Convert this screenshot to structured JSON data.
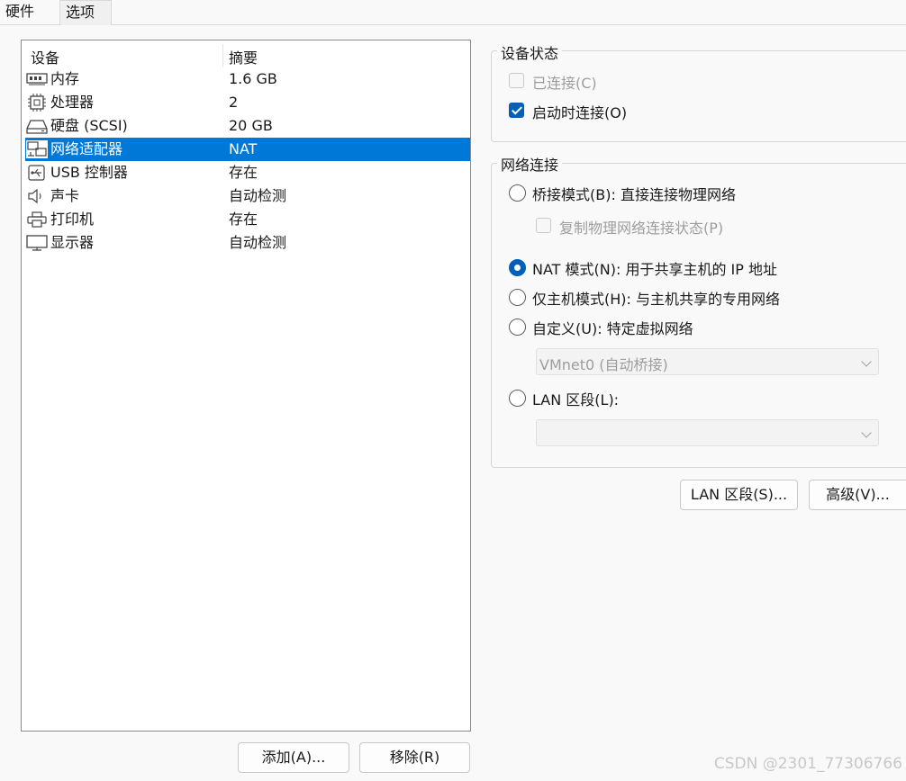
{
  "tabs": [
    {
      "label": "硬件",
      "active": true
    },
    {
      "label": "选项",
      "active": false
    }
  ],
  "device_list": {
    "columns": [
      "设备",
      "摘要"
    ],
    "selected_index": 3,
    "selection_color": "#0078d7",
    "rows": [
      {
        "icon": "memory-icon",
        "name": "内存",
        "summary": "1.6 GB"
      },
      {
        "icon": "processor-icon",
        "name": "处理器",
        "summary": "2"
      },
      {
        "icon": "hard-disk-icon",
        "name": "硬盘 (SCSI)",
        "summary": "20 GB"
      },
      {
        "icon": "network-adapter-icon",
        "name": "网络适配器",
        "summary": "NAT"
      },
      {
        "icon": "usb-icon",
        "name": "USB 控制器",
        "summary": "存在"
      },
      {
        "icon": "speaker-icon",
        "name": "声卡",
        "summary": "自动检测"
      },
      {
        "icon": "printer-icon",
        "name": "打印机",
        "summary": "存在"
      },
      {
        "icon": "display-icon",
        "name": "显示器",
        "summary": "自动检测"
      }
    ]
  },
  "buttons": {
    "add": "添加(A)...",
    "remove": "移除(R)",
    "lan_segments": "LAN 区段(S)...",
    "advanced": "高级(V)..."
  },
  "device_status": {
    "title": "设备状态",
    "connected": {
      "label": "已连接(C)",
      "checked": false,
      "disabled": true
    },
    "connect_at_power_on": {
      "label": "启动时连接(O)",
      "checked": true,
      "disabled": false
    }
  },
  "network_connection": {
    "title": "网络连接",
    "bridged": {
      "label": "桥接模式(B): 直接连接物理网络",
      "checked": false
    },
    "replicate": {
      "label": "复制物理网络连接状态(P)",
      "checked": false,
      "disabled": true
    },
    "nat": {
      "label": "NAT 模式(N): 用于共享主机的 IP 地址",
      "checked": true
    },
    "host_only": {
      "label": "仅主机模式(H): 与主机共享的专用网络",
      "checked": false
    },
    "custom": {
      "label": "自定义(U): 特定虚拟网络",
      "checked": false
    },
    "custom_select_value": "VMnet0 (自动桥接)",
    "lan_segment": {
      "label": "LAN 区段(L):",
      "checked": false
    },
    "lan_select_value": ""
  },
  "watermark": "CSDN @2301_77306766",
  "accent_color": "#005fb8"
}
